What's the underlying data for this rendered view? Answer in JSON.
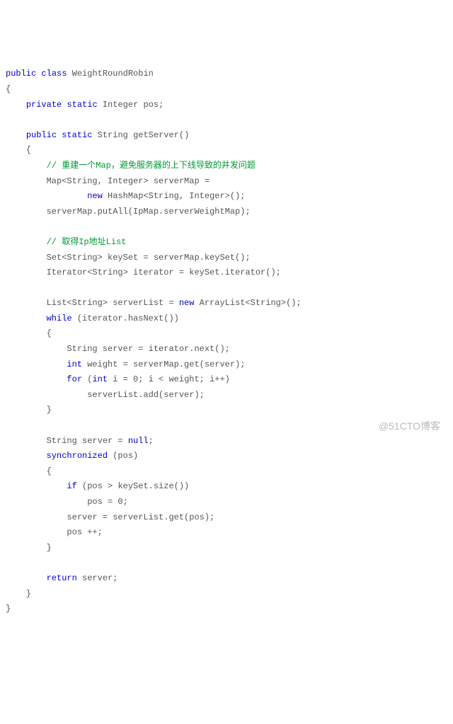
{
  "code": {
    "l1a": "public",
    "l1b": " ",
    "l1c": "class",
    "l1d": " WeightRoundRobin",
    "l2": "{",
    "l3a": "    ",
    "l3b": "private",
    "l3c": " ",
    "l3d": "static",
    "l3e": " Integer pos;",
    "l4": "",
    "l5a": "    ",
    "l5b": "public",
    "l5c": " ",
    "l5d": "static",
    "l5e": " String getServer()",
    "l6": "    {",
    "l7a": "        ",
    "l7b": "// 重建一个Map，避免服务器的上下线导致的并发问题",
    "l8": "        Map<String, Integer> serverMap = ",
    "l9a": "                ",
    "l9b": "new",
    "l9c": " HashMap<String, Integer>();",
    "l10": "        serverMap.putAll(IpMap.serverWeightMap);",
    "l11": "",
    "l12a": "        ",
    "l12b": "// 取得Ip地址List",
    "l13": "        Set<String> keySet = serverMap.keySet();",
    "l14": "        Iterator<String> iterator = keySet.iterator();",
    "l15": "",
    "l16a": "        List<String> serverList = ",
    "l16b": "new",
    "l16c": " ArrayList<String>();",
    "l17a": "        ",
    "l17b": "while",
    "l17c": " (iterator.hasNext())",
    "l18": "        {",
    "l19": "            String server = iterator.next();",
    "l20a": "            ",
    "l20b": "int",
    "l20c": " weight = serverMap.get(server);",
    "l21a": "            ",
    "l21b": "for",
    "l21c": " (",
    "l21d": "int",
    "l21e": " i = 0; i < weight; i++)",
    "l22": "                serverList.add(server);",
    "l23": "        }",
    "l24": "",
    "l25a": "        String server = ",
    "l25b": "null",
    "l25c": ";",
    "l26a": "        ",
    "l26b": "synchronized",
    "l26c": " (pos)",
    "l27": "        {",
    "l28a": "            ",
    "l28b": "if",
    "l28c": " (pos > keySet.size())",
    "l29": "                pos = 0;",
    "l30": "            server = serverList.get(pos);",
    "l31": "            pos ++;",
    "l32": "        }",
    "l33": "",
    "l34a": "        ",
    "l34b": "return",
    "l34c": " server;",
    "l35": "    }",
    "l36": "}"
  },
  "watermark": "@51CTO博客"
}
